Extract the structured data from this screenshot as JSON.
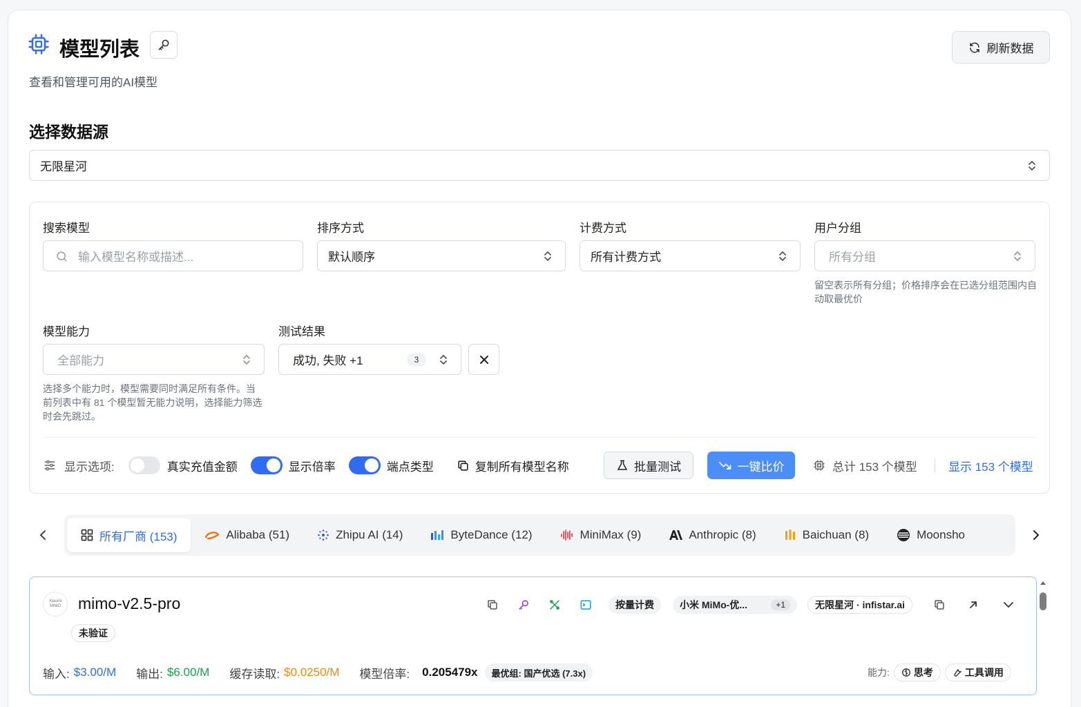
{
  "header": {
    "title": "模型列表",
    "subtitle": "查看和管理可用的AI模型",
    "refresh_label": "刷新数据"
  },
  "source": {
    "heading": "选择数据源",
    "selected": "无限星河"
  },
  "filters": {
    "search": {
      "label": "搜索模型",
      "placeholder": "输入模型名称或描述..."
    },
    "sort": {
      "label": "排序方式",
      "value": "默认顺序"
    },
    "billing": {
      "label": "计费方式",
      "value": "所有计费方式"
    },
    "group": {
      "label": "用户分组",
      "placeholder": "所有分组",
      "hint": "留空表示所有分组；价格排序会在已选分组范围内自动取最优价"
    },
    "capability": {
      "label": "模型能力",
      "placeholder": "全部能力",
      "hint": "选择多个能力时，模型需要同时满足所有条件。当前列表中有 81 个模型暂无能力说明，选择能力筛选时会先跳过。"
    },
    "test_result": {
      "label": "测试结果",
      "value": "成功, 失败 +1",
      "count": "3",
      "clear_icon": "close-icon"
    }
  },
  "options": {
    "label": "显示选项:",
    "toggles": [
      {
        "label": "真实充值金额",
        "on": false
      },
      {
        "label": "显示倍率",
        "on": true
      },
      {
        "label": "端点类型",
        "on": true
      }
    ],
    "copy_label": "复制所有模型名称",
    "batch_label": "批量测试",
    "compare_label": "一键比价",
    "total_label": "总计 153 个模型",
    "shown_label": "显示 153 个模型"
  },
  "vendors": [
    {
      "label": "所有厂商 (153)",
      "icon": "grid-icon",
      "active": true
    },
    {
      "label": "Alibaba (51)",
      "icon": "alibaba-icon",
      "color": "#ff6a00"
    },
    {
      "label": "Zhipu AI (14)",
      "icon": "zhipu-icon",
      "color": "#3b5bdb"
    },
    {
      "label": "ByteDance (12)",
      "icon": "bytedance-icon",
      "color": "#3c8cff"
    },
    {
      "label": "MiniMax (9)",
      "icon": "minimax-icon",
      "color": "#e5484d"
    },
    {
      "label": "Anthropic (8)",
      "icon": "anthropic-icon",
      "color": "#222222"
    },
    {
      "label": "Baichuan (8)",
      "icon": "baichuan-icon",
      "color": "#f59e0b"
    },
    {
      "label": "Moonsho",
      "icon": "moonshot-icon",
      "color": "#222222"
    }
  ],
  "model": {
    "logo_line1": "Xiaomi",
    "logo_line2": "MiMO",
    "name": "mimo-v2.5-pro",
    "status": "未验证",
    "billing_tag": "按量计费",
    "group_tag": "小米 MiMo-优...",
    "group_extra": "+1",
    "source_tag": "无限星河 · infistar.ai",
    "input_label": "输入:",
    "input_price": "$3.00/M",
    "output_label": "输出:",
    "output_price": "$6.00/M",
    "cache_label": "缓存读取:",
    "cache_price": "$0.0250/M",
    "ratio_label": "模型倍率:",
    "ratio_value": "0.205479x",
    "best_group": "最优组: 国产优选 (7.3x)",
    "capability_label": "能力:",
    "capabilities": [
      "思考",
      "工具调用"
    ]
  },
  "colors": {
    "accent": "#2f6cf3",
    "input_price": "#2f6cf3",
    "output_price": "#16a34a",
    "cache_price": "#ea8a0c"
  }
}
